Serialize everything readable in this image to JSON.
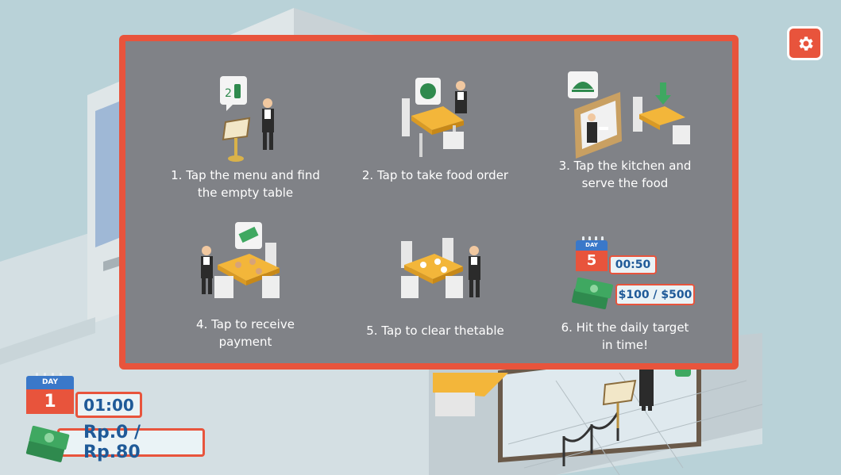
{
  "tutorial": {
    "steps": [
      {
        "caption": "1. Tap the menu and find\nthe empty table"
      },
      {
        "caption": "2. Tap to take food order"
      },
      {
        "caption": "3. Tap the kitchen and\nserve the food"
      },
      {
        "caption": "4. Tap to receive\npayment"
      },
      {
        "caption": "5. Tap to clear thetable"
      },
      {
        "caption": "6. Hit the daily target\nin time!"
      }
    ],
    "target_example": {
      "day_label": "DAY",
      "day": "5",
      "time": "00:50",
      "money": "$100 / $500"
    },
    "table_number": "2"
  },
  "hud": {
    "day_label": "DAY",
    "day": "1",
    "time": "01:00",
    "money": "Rp.0 / Rp.80"
  },
  "icons": {
    "settings": "gear-icon",
    "cash": "cash-icon",
    "calendar": "calendar-icon",
    "ok_hand": "ok-hand-icon"
  },
  "colors": {
    "accent": "#e8543c",
    "panel": "#808287",
    "text_blue": "#1f5a98",
    "calendar_blue": "#3a78c9",
    "background": "#b9d2d8",
    "table_yellow": "#f3b63a",
    "cash_green": "#3fa861"
  }
}
